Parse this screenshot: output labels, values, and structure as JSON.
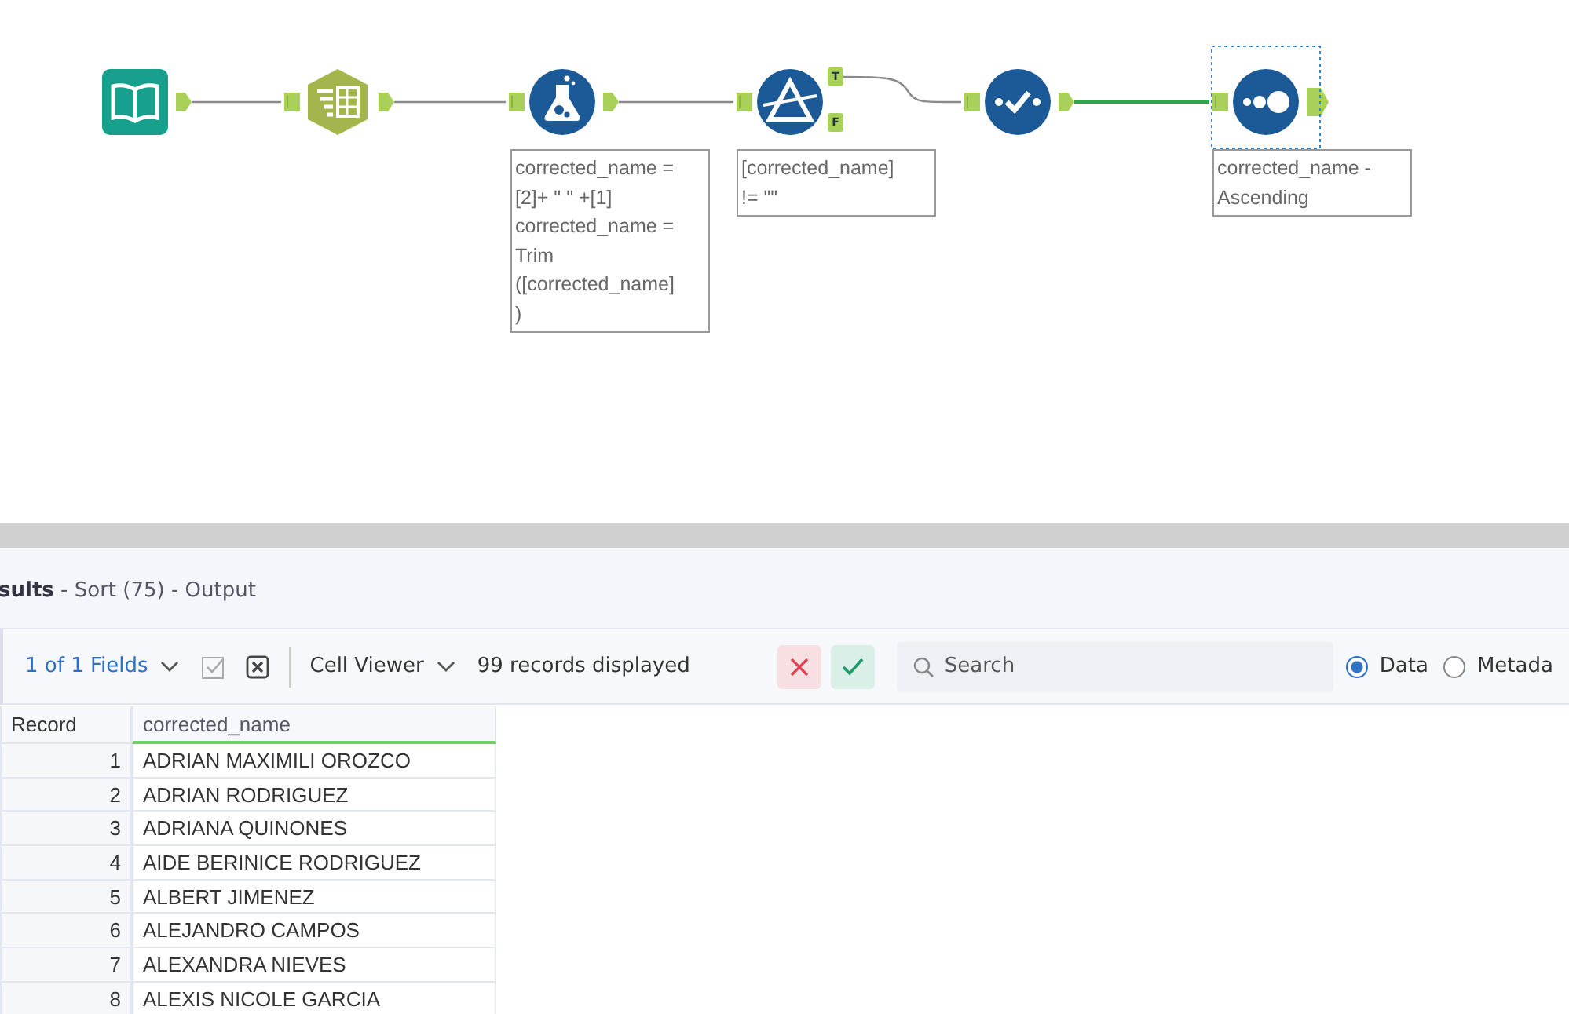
{
  "canvas": {
    "tools": [
      {
        "kind": "input",
        "selected": false
      },
      {
        "kind": "select",
        "selected": false
      },
      {
        "kind": "formula",
        "selected": false,
        "annotation": [
          "corrected_name =",
          "[2]+ \" \" +[1]",
          "corrected_name =",
          "Trim",
          "([corrected_name]",
          ")"
        ]
      },
      {
        "kind": "filter",
        "selected": false,
        "annotation": [
          "[corrected_name]",
          "!= \"\""
        ],
        "outputs": [
          "T",
          "F"
        ]
      },
      {
        "kind": "cleanse",
        "selected": false
      },
      {
        "kind": "sort",
        "selected": true,
        "annotation": [
          "corrected_name -",
          "Ascending"
        ]
      }
    ]
  },
  "results": {
    "title": "**sults** - Sort (75) - Output",
    "toolbar": {
      "fields": "1 of 1 Fields",
      "viewer": "Cell Viewer",
      "count": "99 records displayed",
      "search": {
        "placeholder": "Search"
      },
      "views": [
        {
          "label": "Data",
          "selected": true
        },
        {
          "label": "Metada",
          "selected": false
        }
      ]
    },
    "table": {
      "columns": [
        "Record",
        "corrected_name"
      ],
      "rows": [
        [
          "1",
          "ADRIAN MAXIMILI OROZCO"
        ],
        [
          "2",
          "ADRIAN RODRIGUEZ"
        ],
        [
          "3",
          "ADRIANA QUINONES"
        ],
        [
          "4",
          "AIDE BERINICE RODRIGUEZ"
        ],
        [
          "5",
          "ALBERT JIMENEZ"
        ],
        [
          "6",
          "ALEJANDRO CAMPOS"
        ],
        [
          "7",
          "ALEXANDRA NIEVES"
        ],
        [
          "8",
          "ALEXIS NICOLE GARCIA"
        ]
      ]
    }
  }
}
